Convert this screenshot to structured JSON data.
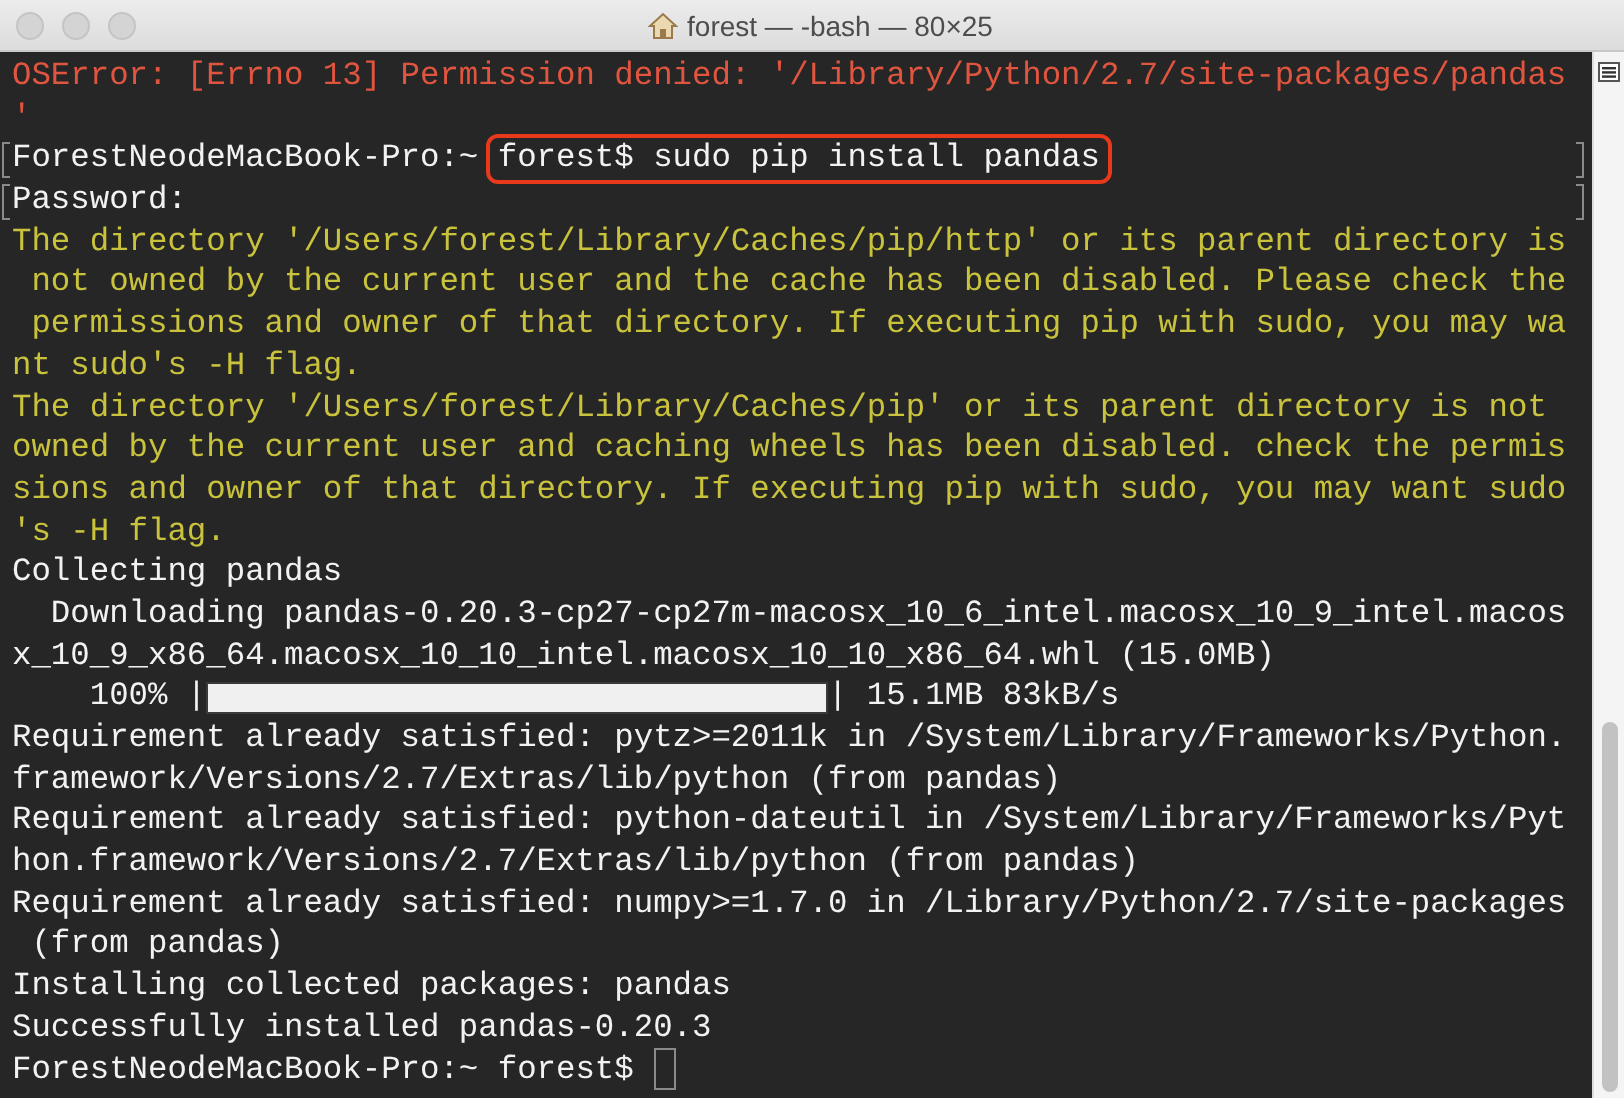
{
  "window": {
    "title": "forest — -bash — 80×25"
  },
  "lines": [
    {
      "kind": "error",
      "text": "OSError: [Errno 13] Permission denied: '/Library/Python/2.7/site-packages/pandas"
    },
    {
      "kind": "error",
      "text": "'"
    },
    {
      "kind": "prompt",
      "text": "ForestNeodeMacBook-Pro:~ ",
      "command": "forest$ sudo pip install pandas",
      "highlighted": true,
      "marked": true
    },
    {
      "kind": "output",
      "text": "Password:",
      "marked": true
    },
    {
      "kind": "warning",
      "text": "The directory '/Users/forest/Library/Caches/pip/http' or its parent directory is"
    },
    {
      "kind": "warning",
      "text": " not owned by the current user and the cache has been disabled. Please check the"
    },
    {
      "kind": "warning",
      "text": " permissions and owner of that directory. If executing pip with sudo, you may wa"
    },
    {
      "kind": "warning",
      "text": "nt sudo's -H flag."
    },
    {
      "kind": "warning",
      "text": "The directory '/Users/forest/Library/Caches/pip' or its parent directory is not"
    },
    {
      "kind": "warning",
      "text": "owned by the current user and caching wheels has been disabled. check the permis"
    },
    {
      "kind": "warning",
      "text": "sions and owner of that directory. If executing pip with sudo, you may want sudo"
    },
    {
      "kind": "warning",
      "text": "'s -H flag."
    },
    {
      "kind": "output",
      "text": "Collecting pandas"
    },
    {
      "kind": "output",
      "text": "  Downloading pandas-0.20.3-cp27-cp27m-macosx_10_6_intel.macosx_10_9_intel.macos"
    },
    {
      "kind": "output",
      "text": "x_10_9_x86_64.macosx_10_10_intel.macosx_10_10_x86_64.whl (15.0MB)"
    },
    {
      "kind": "progress",
      "text": "    100% |",
      "level": 1,
      "suffix": "| 15.1MB 83kB/s"
    },
    {
      "kind": "output",
      "text": "Requirement already satisfied: pytz>=2011k in /System/Library/Frameworks/Python."
    },
    {
      "kind": "output",
      "text": "framework/Versions/2.7/Extras/lib/python (from pandas)"
    },
    {
      "kind": "output",
      "text": "Requirement already satisfied: python-dateutil in /System/Library/Frameworks/Pyt"
    },
    {
      "kind": "output",
      "text": "hon.framework/Versions/2.7/Extras/lib/python (from pandas)"
    },
    {
      "kind": "output",
      "text": "Requirement already satisfied: numpy>=1.7.0 in /Library/Python/2.7/site-packages"
    },
    {
      "kind": "output",
      "text": " (from pandas)"
    },
    {
      "kind": "output",
      "text": "Installing collected packages: pandas"
    },
    {
      "kind": "output",
      "text": "Successfully installed pandas-0.20.3"
    },
    {
      "kind": "prompt",
      "text": "ForestNeodeMacBook-Pro:~ forest$ ",
      "cursor": true
    }
  ]
}
